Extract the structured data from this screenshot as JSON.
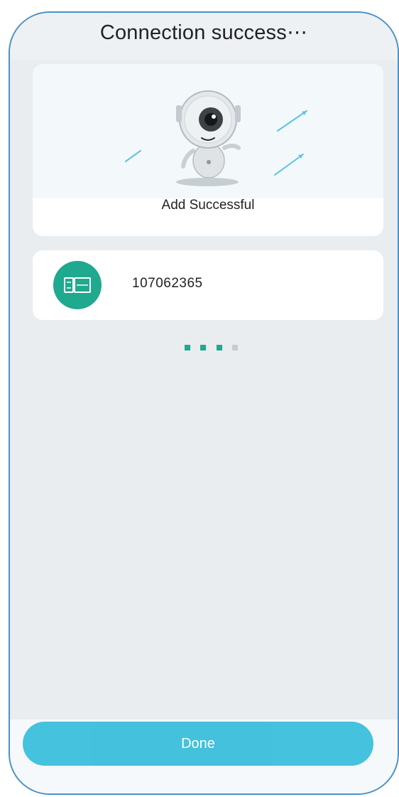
{
  "header": {
    "title": "Connection success⋯"
  },
  "hero": {
    "caption": "Add Successful"
  },
  "device": {
    "name": "107062365",
    "icon": "camera-device-icon"
  },
  "pager": {
    "total": 4,
    "active_count": 3
  },
  "footer": {
    "done_label": "Done"
  },
  "colors": {
    "accent": "#1fa98f",
    "button": "#3bbfdc",
    "frame": "#4a90c9"
  }
}
